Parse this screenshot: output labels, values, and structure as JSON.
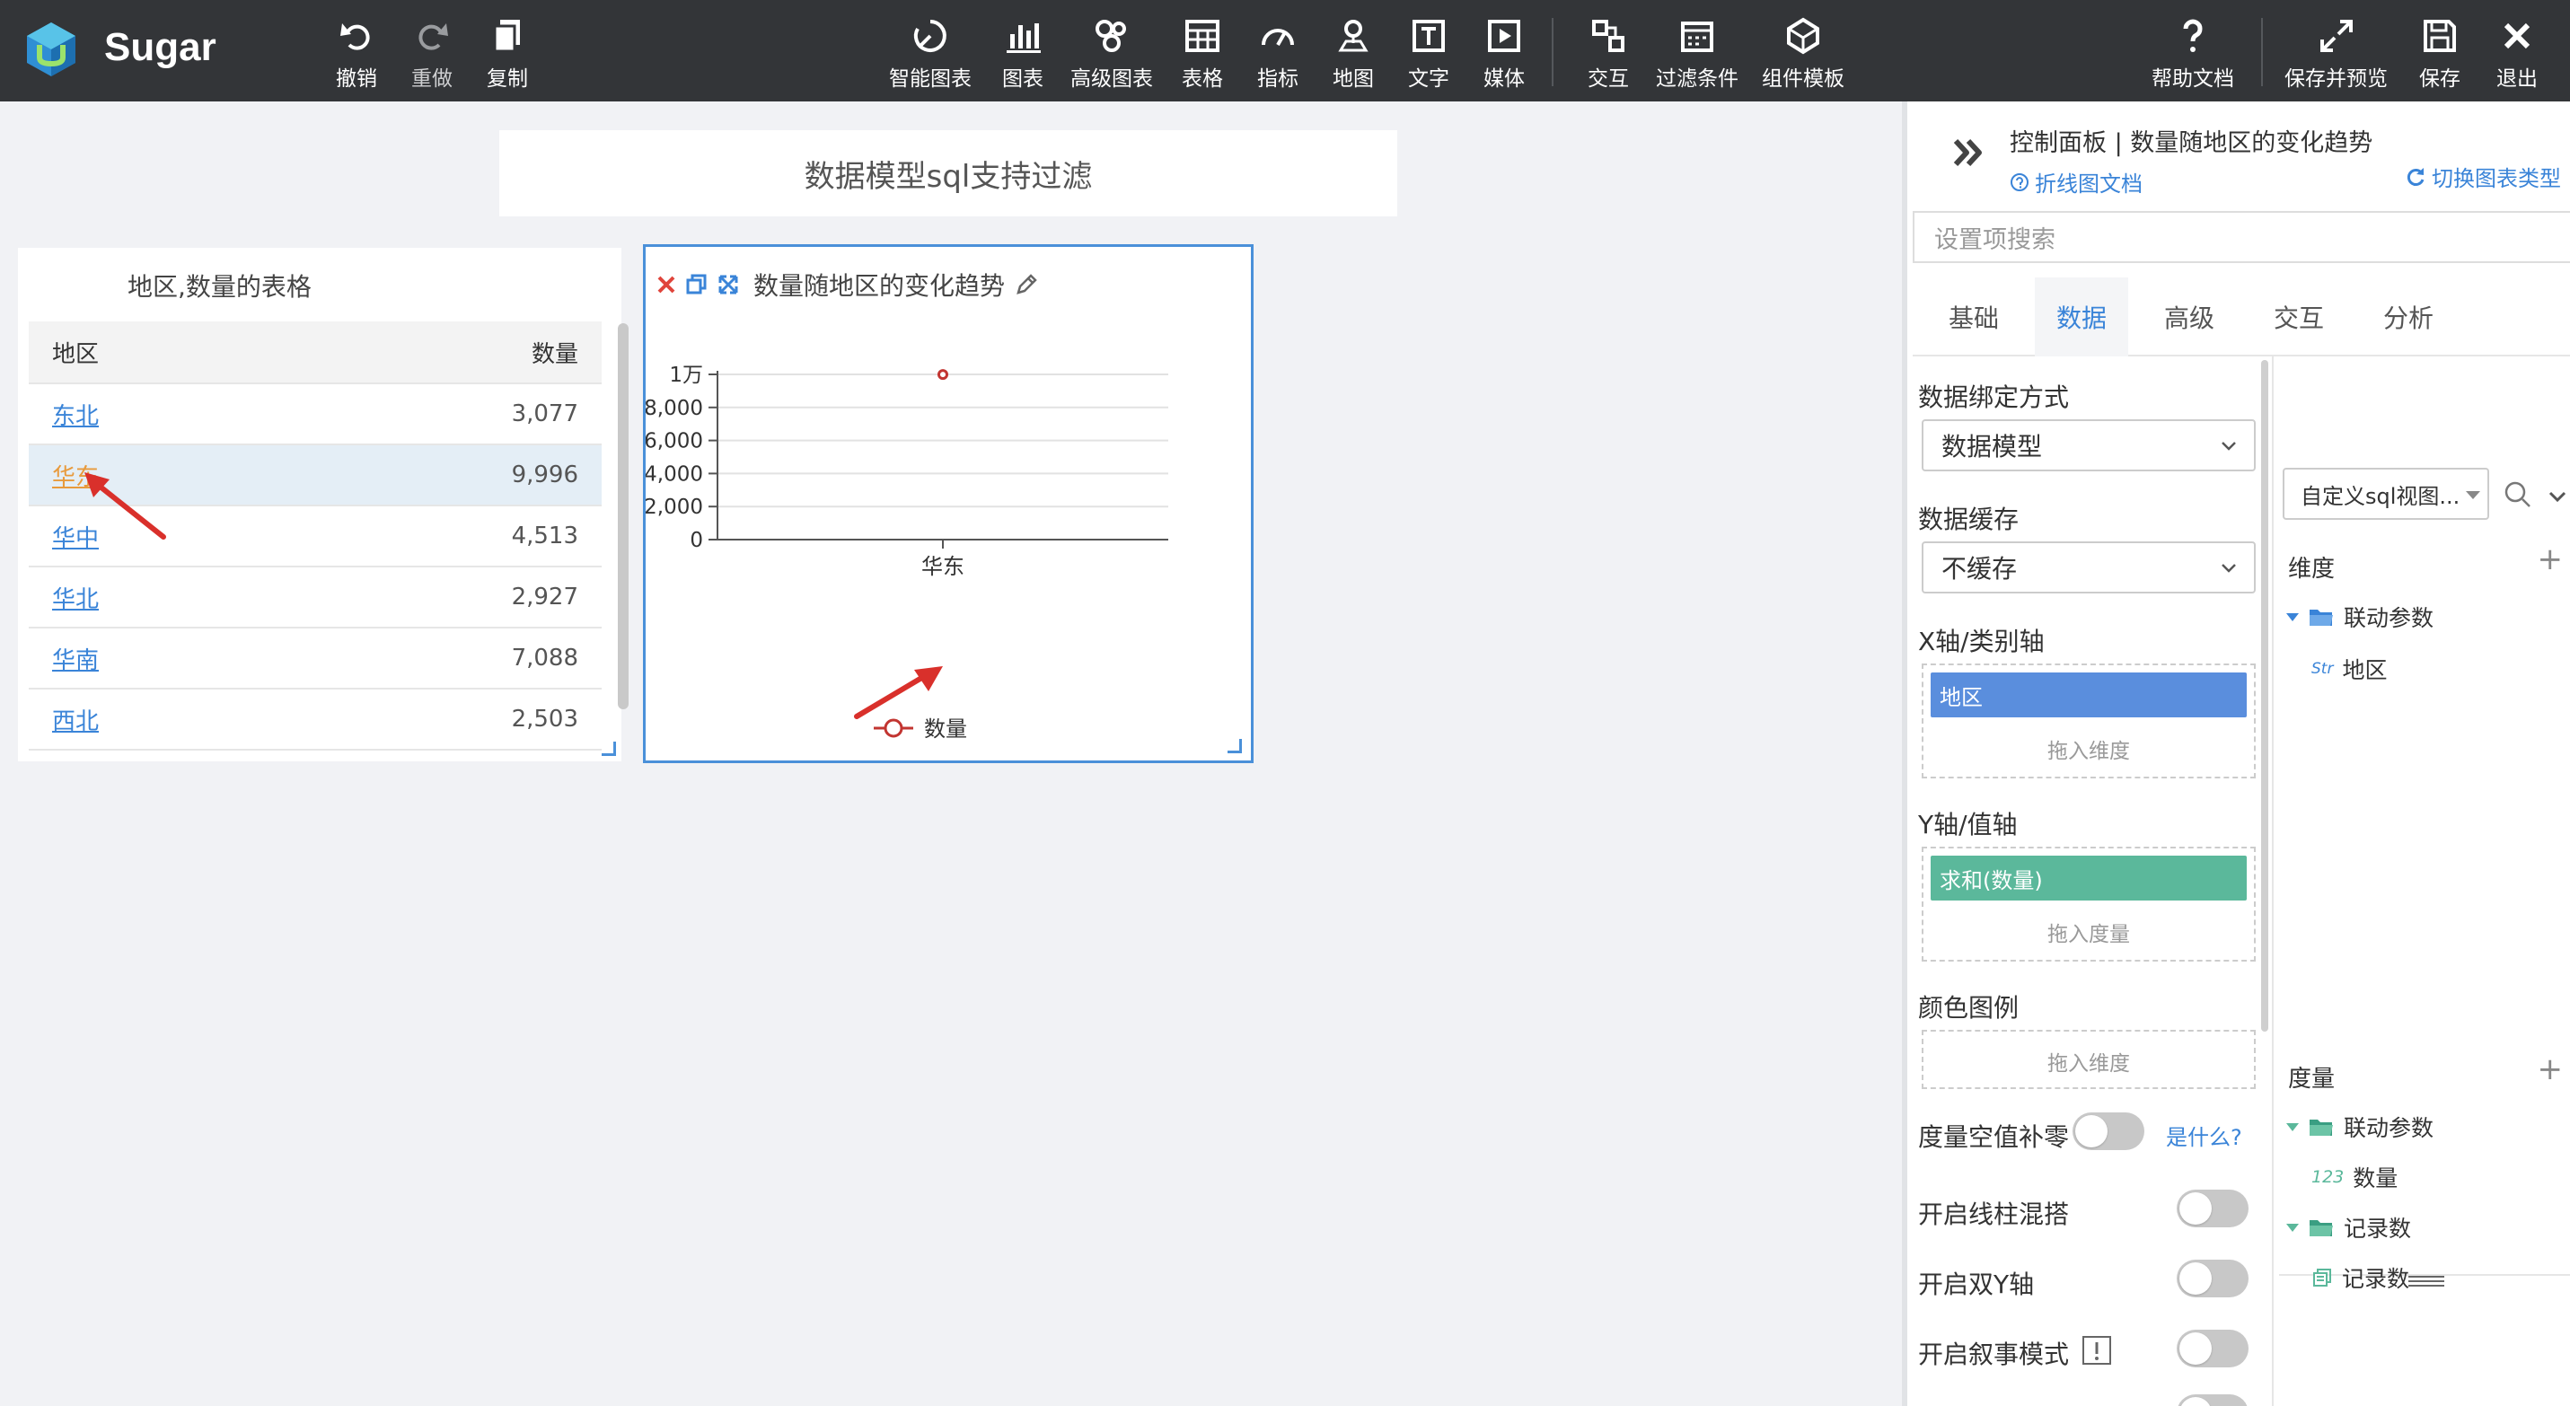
{
  "app": {
    "brand": "Sugar",
    "colors": {
      "toolbar_bg": "#333538",
      "accent": "#3a84d8",
      "x_pill": "#5a8edd",
      "y_pill": "#5bb89b",
      "arrow": "#d9302b"
    }
  },
  "toolbar": {
    "undo": "撤销",
    "redo": "重做",
    "copy": "复制",
    "smart_chart": "智能图表",
    "chart": "图表",
    "advanced_chart": "高级图表",
    "table": "表格",
    "indicator": "指标",
    "map": "地图",
    "text": "文字",
    "media": "媒体",
    "interaction": "交互",
    "filter": "过滤条件",
    "component_template": "组件模板",
    "help": "帮助文档",
    "save_preview": "保存并预览",
    "save": "保存",
    "exit": "退出"
  },
  "canvas": {
    "page_title": "数据模型sql支持过滤",
    "table_card": {
      "title": "地区,数量的表格",
      "headers": [
        "地区",
        "数量"
      ],
      "rows": [
        {
          "region": "东北",
          "value": "3,077"
        },
        {
          "region": "华东",
          "value": "9,996"
        },
        {
          "region": "华中",
          "value": "4,513"
        },
        {
          "region": "华北",
          "value": "2,927"
        },
        {
          "region": "华南",
          "value": "7,088"
        },
        {
          "region": "西北",
          "value": "2,503"
        }
      ]
    },
    "chart_card": {
      "title": "数量随地区的变化趋势"
    }
  },
  "chart_data": {
    "type": "line",
    "title": "数量随地区的变化趋势",
    "categories": [
      "华东"
    ],
    "series": [
      {
        "name": "数量",
        "values": [
          9996
        ]
      }
    ],
    "ylim": [
      0,
      10000
    ],
    "y_ticks": [
      "0",
      "2,000",
      "4,000",
      "6,000",
      "8,000",
      "1万"
    ],
    "grid": true,
    "legend": "bottom"
  },
  "panel": {
    "title": "控制面板 | 数量随地区的变化趋势",
    "doc_link": "折线图文档",
    "switch_type": "切换图表类型",
    "search_placeholder": "设置项搜索",
    "tabs": [
      "基础",
      "数据",
      "高级",
      "交互",
      "分析"
    ],
    "active_tab": "数据",
    "binding_label": "数据绑定方式",
    "binding_value": "数据模型",
    "cache_label": "数据缓存",
    "cache_value": "不缓存",
    "x_axis_label": "X轴/类别轴",
    "x_axis_field": "地区",
    "x_drop_hint": "拖入维度",
    "y_axis_label": "Y轴/值轴",
    "y_axis_field": "求和(数量)",
    "y_drop_hint": "拖入度量",
    "color_label": "颜色图例",
    "color_drop_hint": "拖入维度",
    "zero_fill_label": "度量空值补零",
    "what_is": "是什么?",
    "mix_label": "开启线柱混搭",
    "dual_y_label": "开启双Y轴",
    "narrative_label": "开启叙事模式",
    "datasource": "自定义sql视图...",
    "dimension_title": "维度",
    "measure_title": "度量",
    "dim_folder": "联动参数",
    "dim_field_type": "Str",
    "dim_field": "地区",
    "mea_folder": "联动参数",
    "mea_field_type": "123",
    "mea_field": "数量",
    "record_folder": "记录数",
    "record_field": "记录数"
  }
}
